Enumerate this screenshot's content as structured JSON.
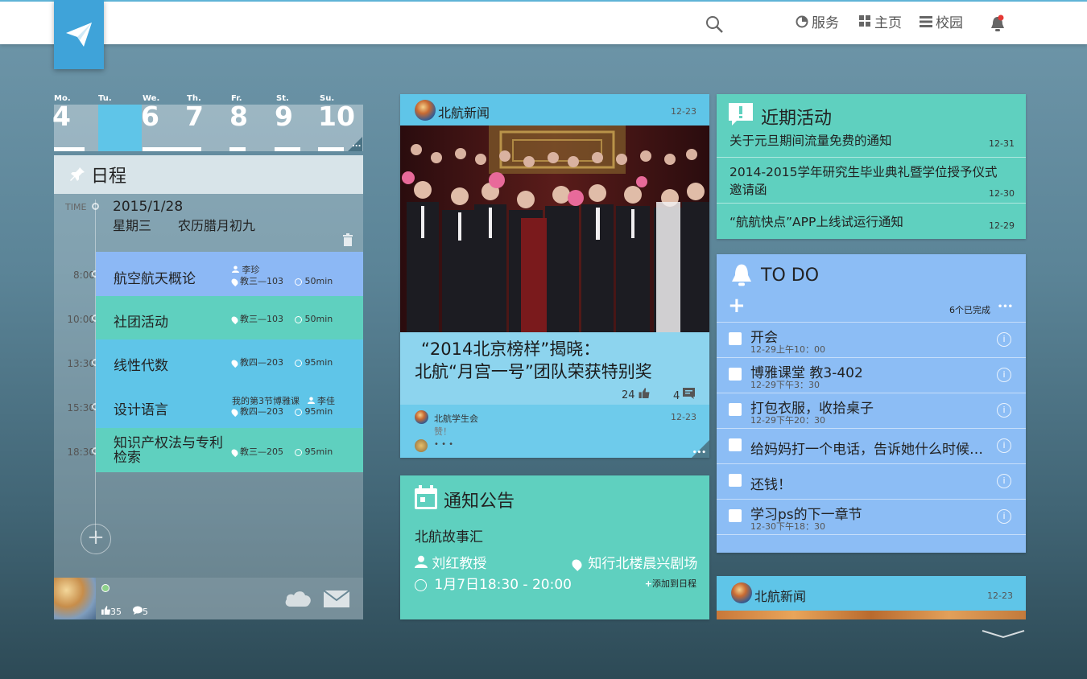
{
  "nav": {
    "service": "服务",
    "home": "主页",
    "campus": "校园"
  },
  "week": {
    "days": [
      {
        "name": "Mo.",
        "num": "4"
      },
      {
        "name": "Tu.",
        "num": ""
      },
      {
        "name": "We.",
        "num": "6"
      },
      {
        "name": "Th.",
        "num": "7"
      },
      {
        "name": "Fr.",
        "num": "8"
      },
      {
        "name": "St.",
        "num": "9"
      },
      {
        "name": "Su.",
        "num": "10"
      }
    ],
    "more": "..."
  },
  "schedule": {
    "title": "日程",
    "time_label": "TIME",
    "date": "2015/1/28",
    "weekday": "星期三",
    "lunar": "农历腊月初九",
    "events": [
      {
        "time": "8:00",
        "name": "航空航天概论",
        "teacher": "李珍",
        "room": "教三—103",
        "duration": "50min",
        "color": "#8cb8f5"
      },
      {
        "time": "10:00",
        "name": "社团活动",
        "teacher": "",
        "room": "教三—103",
        "duration": "50min",
        "color": "#5fd0bf"
      },
      {
        "time": "13:30",
        "name": "线性代数",
        "teacher": "",
        "room": "教四—203",
        "duration": "95min",
        "color": "#5fc5e8"
      },
      {
        "time": "15:30",
        "name": "设计语言",
        "note": "我的第3节博雅课",
        "teacher": "李佳",
        "room": "教四—203",
        "duration": "95min",
        "color": "#5fc5e8"
      },
      {
        "time": "18:30",
        "name": "知识产权法与专利检索",
        "teacher": "",
        "room": "教三—205",
        "duration": "95min",
        "color": "#5fd0bf"
      }
    ],
    "likes": "35",
    "comments": "5"
  },
  "news": {
    "source": "北航新闻",
    "date": "12-23",
    "title_line1": "“2014北京榜样”揭晓：",
    "title_line2": "北航“月宫一号”团队荣获特别奖",
    "likes": "24",
    "comments": "4",
    "comment_user": "北航学生会",
    "comment_text": "赞！",
    "comment_date": "12-23",
    "more_dots": "• • •"
  },
  "notice": {
    "title": "通知公告",
    "subtitle": "北航故事汇",
    "speaker": "刘红教授",
    "location": "知行北楼晨兴剧场",
    "time": "1月7日18:30 - 20:00",
    "add_label": "添加到日程"
  },
  "activities": {
    "title": "近期活动",
    "items": [
      {
        "text": "关于元旦期间流量免费的通知",
        "date": "12-31"
      },
      {
        "text": "2014-2015学年研究生毕业典礼暨学位授予仪式邀请函",
        "date": "12-30"
      },
      {
        "text": "“航航快点”APP上线试运行通知",
        "date": "12-29"
      }
    ]
  },
  "todo": {
    "title": "TO DO",
    "done_count": "6个已完成",
    "items": [
      {
        "title": "开会",
        "time": "12-29上午10：00"
      },
      {
        "title": "博雅课堂 教3-402",
        "time": "12-29下午3：30"
      },
      {
        "title": "打包衣服，收拾桌子",
        "time": "12-29下午20：30"
      },
      {
        "title": "给妈妈打一个电话，告诉她什么时候回家",
        "time": ""
      },
      {
        "title": "还钱！",
        "time": ""
      },
      {
        "title": "学习ps的下一章节",
        "time": "12-30下午18：30"
      }
    ]
  },
  "news2": {
    "source": "北航新闻",
    "date": "12-23"
  },
  "colors": {
    "accent_blue": "#3fa3d9",
    "teal": "#5fd0bf",
    "sky": "#5fc5e8",
    "lavender": "#8cbdf5",
    "notification_dot": "#e53935"
  }
}
